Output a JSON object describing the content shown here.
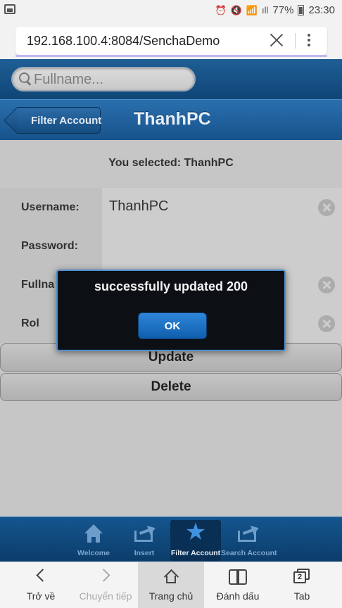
{
  "status_bar": {
    "signal_text": "ıll",
    "battery": "77%",
    "time": "23:30"
  },
  "browser": {
    "url": "192.168.100.4:8084/SenchaDemo"
  },
  "search": {
    "placeholder": "Fullname..."
  },
  "titlebar": {
    "back_label": "Filter Account",
    "title": "ThanhPC"
  },
  "content": {
    "selected_text": "You selected: ThanhPC",
    "fields": [
      {
        "label": "Username:",
        "value": "ThanhPC"
      },
      {
        "label": "Password:",
        "value": ""
      },
      {
        "label": "Fullna",
        "value": ""
      },
      {
        "label": "Rol",
        "value": ""
      }
    ],
    "update_label": "Update",
    "delete_label": "Delete"
  },
  "modal": {
    "message": "successfully updated 200",
    "ok_label": "OK"
  },
  "app_tabs": [
    {
      "label": "Welcome",
      "icon": "home-icon"
    },
    {
      "label": "Insert",
      "icon": "share-icon"
    },
    {
      "label": "Filter Account",
      "icon": "star-icon",
      "active": true
    },
    {
      "label": "Search Account",
      "icon": "share-icon"
    }
  ],
  "browser_nav": [
    {
      "label": "Trở về",
      "icon": "back-icon"
    },
    {
      "label": "Chuyển tiếp",
      "icon": "forward-icon"
    },
    {
      "label": "Trang chủ",
      "icon": "home-icon",
      "active": true
    },
    {
      "label": "Đánh dấu",
      "icon": "bookmark-icon"
    },
    {
      "label": "Tab",
      "icon": "tabs-icon",
      "count": "2"
    }
  ],
  "colors": {
    "accent": "#1a5a96",
    "ok_button": "#1e73c4",
    "modal_bg": "#0c0f14"
  }
}
